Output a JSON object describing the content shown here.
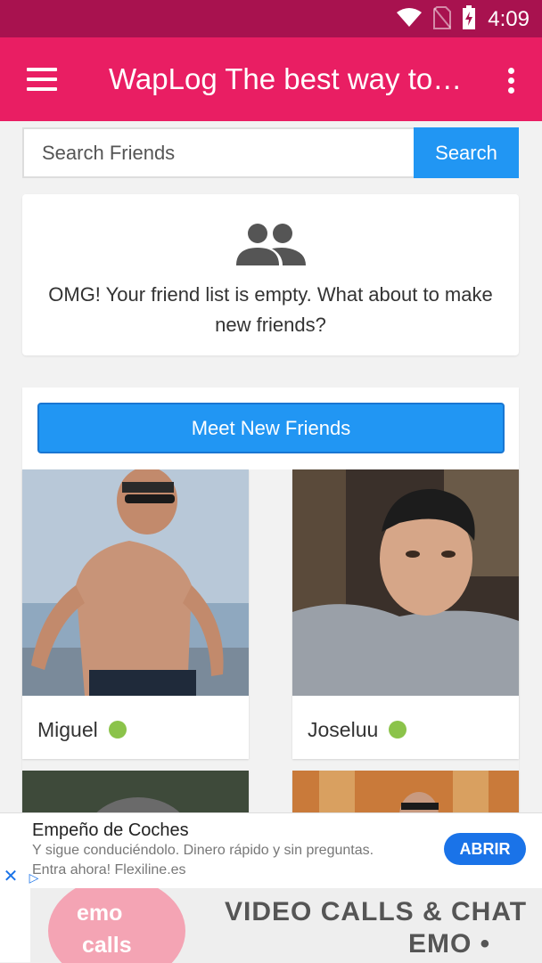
{
  "status_bar": {
    "time": "4:09",
    "icons": [
      "wifi-icon",
      "no-sim-icon",
      "battery-charging-icon"
    ]
  },
  "app_bar": {
    "title": "WapLog The best way to…",
    "menu_icon": "hamburger-menu-icon",
    "more_icon": "more-vert-icon",
    "color": "#e91e63"
  },
  "search": {
    "placeholder": "Search Friends",
    "value": "",
    "button_label": "Search"
  },
  "empty_state": {
    "icon": "people-icon",
    "message": "OMG! Your friend list is empty. What about to make new friends?"
  },
  "meet": {
    "button_label": "Meet New Friends"
  },
  "friends": [
    {
      "name": "Miguel",
      "online": true,
      "photo": "photo-shirtless-man-sunglasses"
    },
    {
      "name": "Joseluu",
      "online": true,
      "photo": "photo-man-grey-hoodie"
    },
    {
      "name": "",
      "online": false,
      "photo": "photo-man-curly-hair"
    },
    {
      "name": "",
      "online": false,
      "photo": "photo-man-sunglasses-indoor"
    }
  ],
  "ad": {
    "title": "Empeño de Coches",
    "subtitle": "Y sigue conduciéndolo. Dinero rápido y sin preguntas.",
    "subtitle2": "Entra ahora! Flexiline.es",
    "button_label": "ABRIR",
    "close_icon": "close-icon",
    "adchoices_icon": "adchoices-icon"
  },
  "banner": {
    "circle_line1": "emo",
    "circle_line2": "calls",
    "line1": "VIDEO CALLS & CHAT",
    "line2": "EMO •"
  },
  "colors": {
    "primary": "#e91e63",
    "status": "#a8124f",
    "accent": "#2196f3",
    "online": "#8bc34a"
  }
}
